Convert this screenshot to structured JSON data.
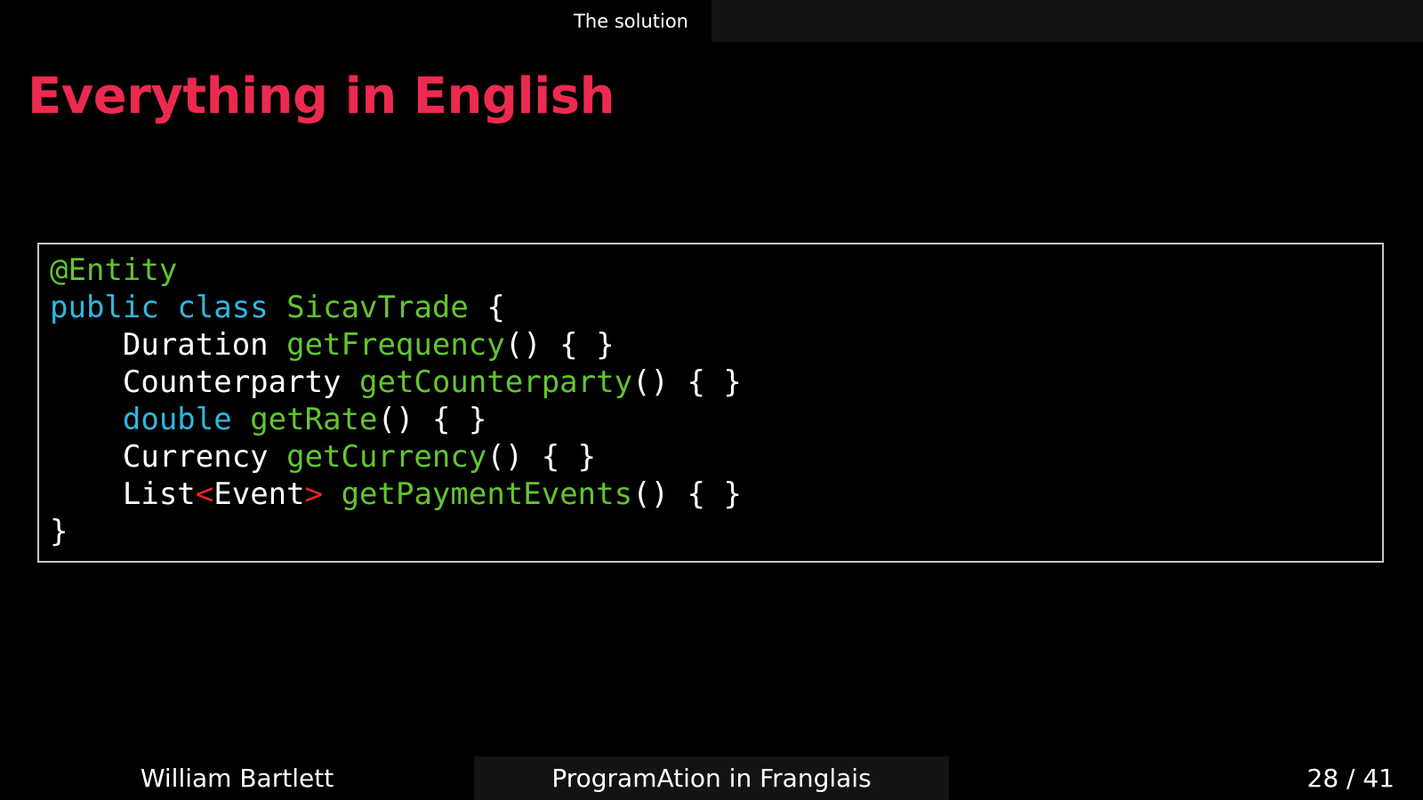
{
  "header": {
    "section": "The solution"
  },
  "slide": {
    "title": "Everything in English"
  },
  "code": {
    "lines": [
      [
        {
          "t": "@Entity",
          "c": "annotation"
        }
      ],
      [
        {
          "t": "public",
          "c": "keyword"
        },
        {
          "t": " ",
          "c": "plain"
        },
        {
          "t": "class",
          "c": "keyword"
        },
        {
          "t": " ",
          "c": "plain"
        },
        {
          "t": "SicavTrade",
          "c": "class"
        },
        {
          "t": " {",
          "c": "plain"
        }
      ],
      [
        {
          "t": "    Duration ",
          "c": "plain"
        },
        {
          "t": "getFrequency",
          "c": "method"
        },
        {
          "t": "() { }",
          "c": "plain"
        }
      ],
      [
        {
          "t": "    Counterparty ",
          "c": "plain"
        },
        {
          "t": "getCounterparty",
          "c": "method"
        },
        {
          "t": "() { }",
          "c": "plain"
        }
      ],
      [
        {
          "t": "    ",
          "c": "plain"
        },
        {
          "t": "double",
          "c": "keyword"
        },
        {
          "t": " ",
          "c": "plain"
        },
        {
          "t": "getRate",
          "c": "method"
        },
        {
          "t": "() { }",
          "c": "plain"
        }
      ],
      [
        {
          "t": "    Currency ",
          "c": "plain"
        },
        {
          "t": "getCurrency",
          "c": "method"
        },
        {
          "t": "() { }",
          "c": "plain"
        }
      ],
      [
        {
          "t": "    List",
          "c": "plain"
        },
        {
          "t": "<",
          "c": "generic"
        },
        {
          "t": "Event",
          "c": "plain"
        },
        {
          "t": ">",
          "c": "generic"
        },
        {
          "t": " ",
          "c": "plain"
        },
        {
          "t": "getPaymentEvents",
          "c": "method"
        },
        {
          "t": "() { }",
          "c": "plain"
        }
      ],
      [
        {
          "t": "}",
          "c": "plain"
        }
      ]
    ]
  },
  "footer": {
    "author": "William Bartlett",
    "talk": "ProgramAtion in Franglais",
    "page": "28 / 41"
  },
  "colors": {
    "title": "#ec2a4f",
    "annotation": "#63c52f",
    "keyword": "#2fb8e0",
    "generic": "#e8242c"
  }
}
